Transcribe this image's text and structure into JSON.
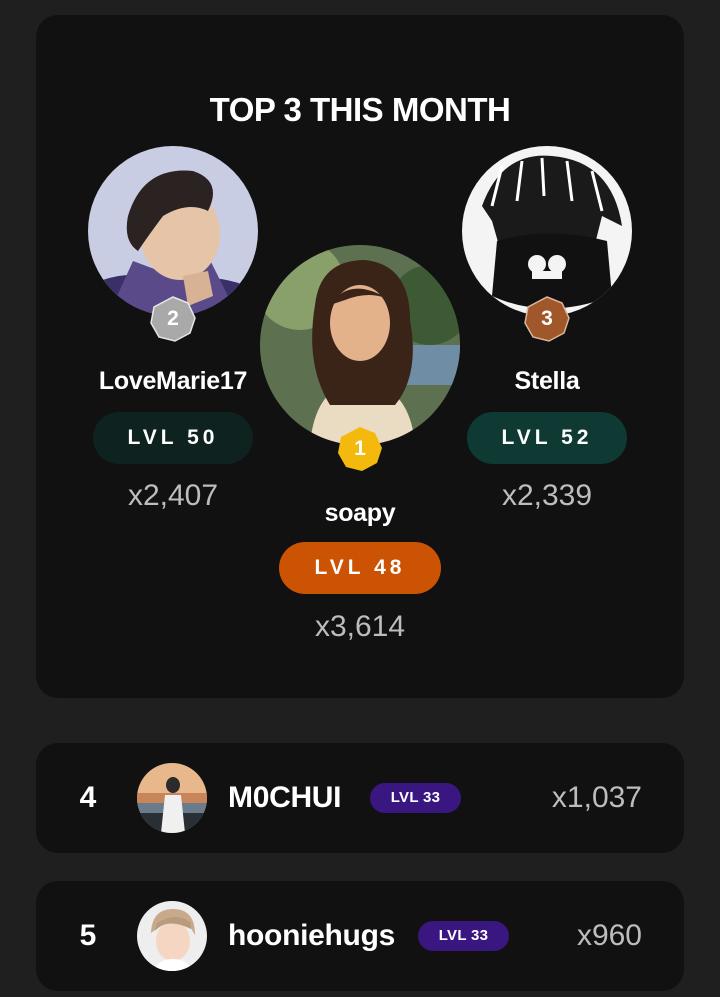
{
  "podium": {
    "title": "TOP 3 THIS MONTH",
    "second": {
      "rank": "2",
      "name": "LoveMarie17",
      "level": "LVL 50",
      "score": "x2,407",
      "badge_color": "#a9a9a9",
      "pill_color": "#0e2220",
      "avatar_icon": "user-photo"
    },
    "first": {
      "rank": "1",
      "name": "soapy",
      "level": "LVL 48",
      "score": "x3,614",
      "badge_color": "#f4b90d",
      "pill_color": "#cc5304",
      "avatar_icon": "user-photo"
    },
    "third": {
      "rank": "3",
      "name": "Stella",
      "level": "LVL 52",
      "score": "x2,339",
      "badge_color": "#a0582a",
      "pill_color": "#0f3a34",
      "avatar_icon": "user-photo"
    }
  },
  "list": [
    {
      "rank": "4",
      "name": "M0CHUI",
      "level": "LVL 33",
      "score": "x1,037",
      "avatar_icon": "user-photo"
    },
    {
      "rank": "5",
      "name": "hooniehugs",
      "level": "LVL 33",
      "score": "x960",
      "avatar_icon": "user-photo"
    }
  ]
}
